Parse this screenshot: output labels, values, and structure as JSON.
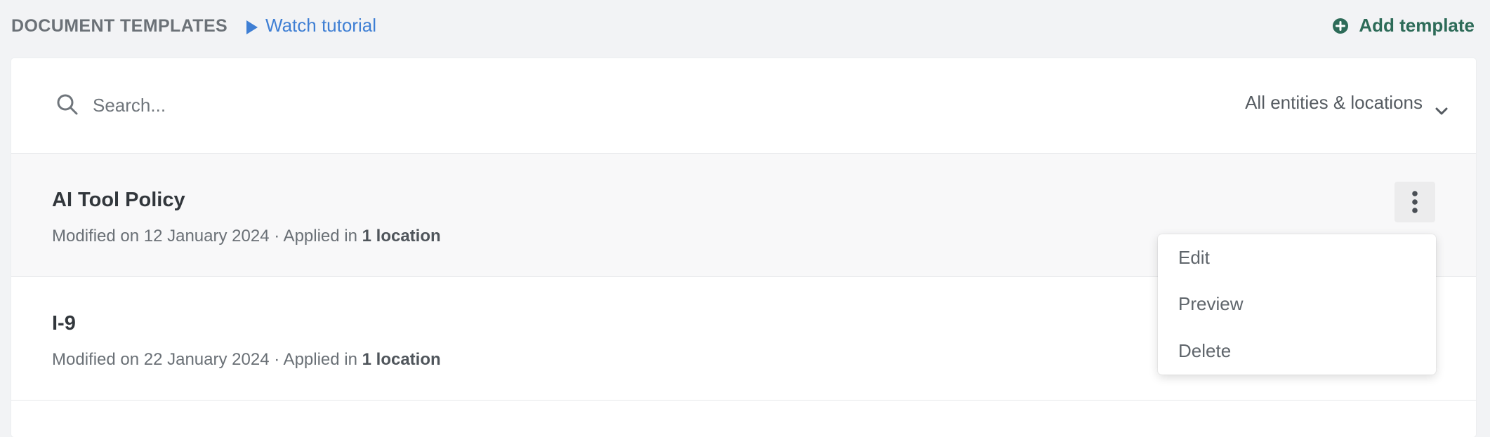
{
  "header": {
    "title": "DOCUMENT TEMPLATES",
    "watch_label": "Watch tutorial",
    "add_label": "Add template"
  },
  "search": {
    "placeholder": "Search...",
    "value": ""
  },
  "filter": {
    "selected": "All entities & locations"
  },
  "templates": [
    {
      "name": "AI Tool Policy",
      "modified": "Modified on 12 January 2024 · Applied in",
      "applied": "1 location"
    },
    {
      "name": "I-9",
      "modified": "Modified on 22 January 2024 · Applied in",
      "applied": "1 location"
    }
  ],
  "menu": {
    "items": [
      "Edit",
      "Preview",
      "Delete"
    ]
  },
  "colors": {
    "accent_link": "#3f7fd4",
    "add_green": "#2d6b58",
    "background": "#f2f3f5"
  },
  "icons": {
    "play": "play-icon",
    "add": "plus-circle-icon",
    "search": "search-icon",
    "chevron": "chevron-down-icon",
    "kebab": "more-vertical-icon"
  }
}
